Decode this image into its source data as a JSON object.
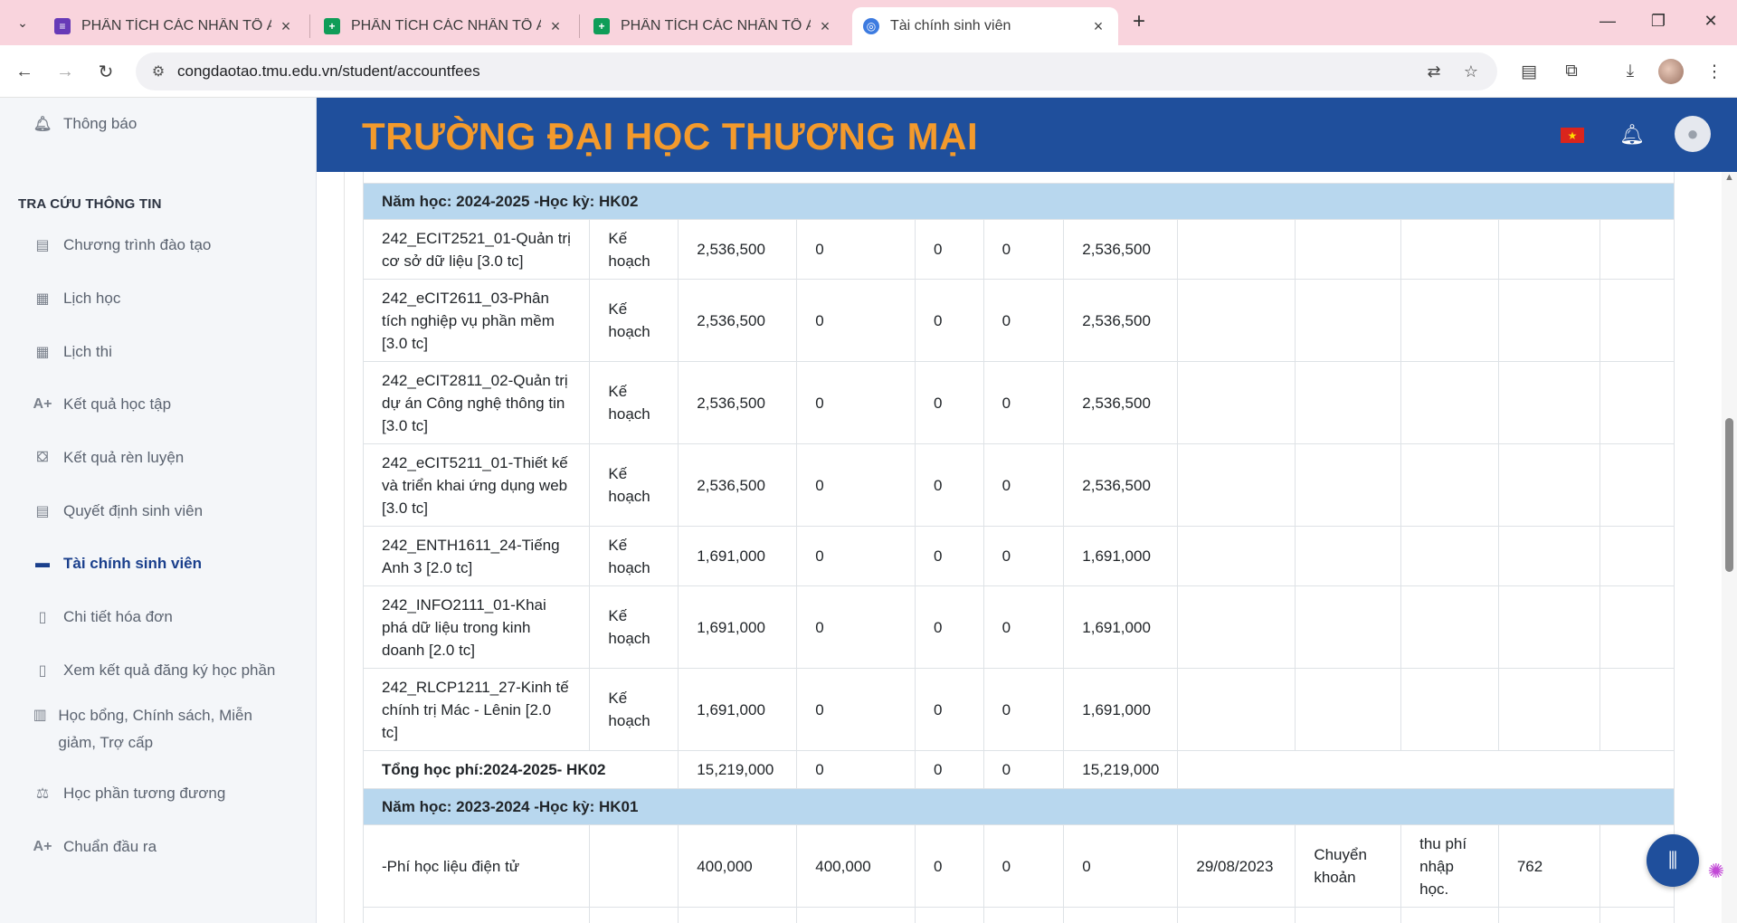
{
  "browser": {
    "tabs": [
      {
        "title": "PHÂN TÍCH CÁC NHÂN TỐ ẢNH",
        "color": "#673ab7"
      },
      {
        "title": "PHÂN TÍCH CÁC NHÂN TỐ ẢNH",
        "color": "#0f9d58"
      },
      {
        "title": "PHÂN TÍCH CÁC NHÂN TỐ ẢNH",
        "color": "#0f9d58"
      },
      {
        "title": "Tài chính sinh viên",
        "color": "#3d7be0"
      }
    ],
    "url": "congdaotao.tmu.edu.vn/student/accountfees"
  },
  "sidebar": {
    "top_item": "Thông báo",
    "section_heading": "TRA CỨU THÔNG TIN",
    "items": [
      {
        "label": "Chương trình đào tạo",
        "icon": "clipboard-icon"
      },
      {
        "label": "Lịch học",
        "icon": "calendar-icon"
      },
      {
        "label": "Lịch thi",
        "icon": "calendar-icon"
      },
      {
        "label": "Kết quả học tập",
        "icon": "grade-icon",
        "glyph": "A+"
      },
      {
        "label": "Kết quả rèn luyện",
        "icon": "training-icon"
      },
      {
        "label": "Quyết định sinh viên",
        "icon": "clipboard-icon"
      },
      {
        "label": "Tài chính sinh viên",
        "icon": "card-icon"
      },
      {
        "label": "Chi tiết hóa đơn",
        "icon": "document-icon"
      },
      {
        "label": "Xem kết quả đăng ký học phần",
        "icon": "document-icon"
      },
      {
        "label": "Học bổng, Chính sách, Miễn giảm, Trợ cấp",
        "icon": "chart-icon"
      },
      {
        "label": "Học phần tương đương",
        "icon": "scale-icon"
      },
      {
        "label": "Chuẩn đầu ra",
        "icon": "grade-icon",
        "glyph": "A+"
      }
    ]
  },
  "header": {
    "school_name": "TRƯỜNG ĐẠI HỌC THƯƠNG MẠI"
  },
  "fees": {
    "semester_hk02": "Năm học: 2024-2025 -Học kỳ: HK02",
    "rows_hk02": [
      {
        "course": "242_ECIT2521_01-Quản trị cơ sở dữ liệu [3.0 tc]",
        "status": "Kế hoạch",
        "fee": "2,536,500",
        "c1": "0",
        "c2": "0",
        "c3": "0",
        "due": "2,536,500"
      },
      {
        "course": "242_eCIT2611_03-Phân tích nghiệp vụ phần mềm [3.0 tc]",
        "status": "Kế hoạch",
        "fee": "2,536,500",
        "c1": "0",
        "c2": "0",
        "c3": "0",
        "due": "2,536,500"
      },
      {
        "course": "242_eCIT2811_02-Quản trị dự án Công nghệ thông tin [3.0 tc]",
        "status": "Kế hoạch",
        "fee": "2,536,500",
        "c1": "0",
        "c2": "0",
        "c3": "0",
        "due": "2,536,500"
      },
      {
        "course": "242_eCIT5211_01-Thiết kế và triển khai ứng dụng web [3.0 tc]",
        "status": "Kế hoạch",
        "fee": "2,536,500",
        "c1": "0",
        "c2": "0",
        "c3": "0",
        "due": "2,536,500"
      },
      {
        "course": "242_ENTH1611_24-Tiếng Anh 3 [2.0 tc]",
        "status": "Kế hoạch",
        "fee": "1,691,000",
        "c1": "0",
        "c2": "0",
        "c3": "0",
        "due": "1,691,000"
      },
      {
        "course": "242_INFO2111_01-Khai phá dữ liệu trong kinh doanh [2.0 tc]",
        "status": "Kế hoạch",
        "fee": "1,691,000",
        "c1": "0",
        "c2": "0",
        "c3": "0",
        "due": "1,691,000"
      },
      {
        "course": "242_RLCP1211_27-Kinh tế chính trị Mác - Lênin [2.0 tc]",
        "status": "Kế hoạch",
        "fee": "1,691,000",
        "c1": "0",
        "c2": "0",
        "c3": "0",
        "due": "1,691,000"
      }
    ],
    "total_hk02": {
      "label": "Tổng học phí:2024-2025- HK02",
      "fee": "15,219,000",
      "c1": "0",
      "c2": "0",
      "c3": "0",
      "due": "15,219,000"
    },
    "semester_hk01": "Năm học: 2023-2024 -Học kỳ: HK01",
    "row_hk01": {
      "course": "-Phí học liệu điện tử",
      "fee": "400,000",
      "paid": "400,000",
      "c2": "0",
      "c3": "0",
      "due": "0",
      "date": "29/08/2023",
      "method": "Chuyển khoản",
      "note": "thu phí nhập học.",
      "receipt": "762"
    }
  }
}
